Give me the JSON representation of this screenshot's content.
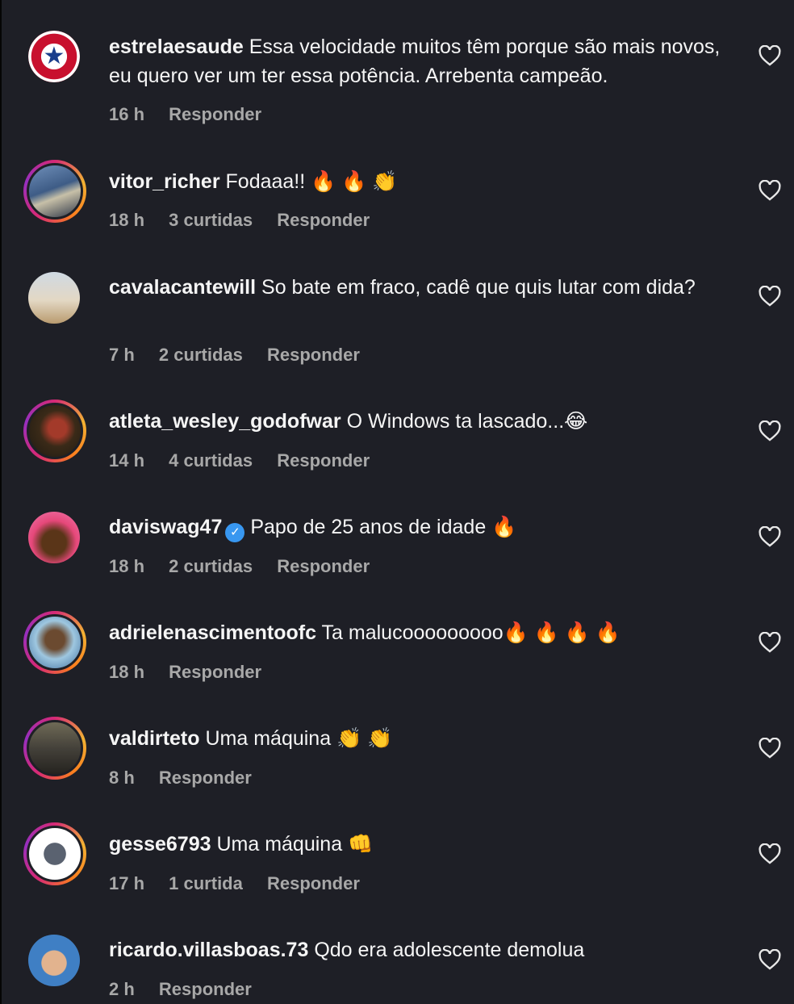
{
  "comments": [
    {
      "username": "estrelaesaude",
      "text": "Essa velocidade muitos têm porque são mais novos, eu quero ver um ter essa potência. Arrebenta campeão.",
      "time": "16 h",
      "likes": "",
      "reply_label": "Responder",
      "avatar_icon": "star-logo"
    },
    {
      "username": "vitor_richer",
      "text": "Fodaaa!! 🔥 🔥 👏",
      "time": "18 h",
      "likes": "3 curtidas",
      "reply_label": "Responder"
    },
    {
      "username": "cavalacantewill",
      "text": "So bate em fraco, cadê que quis lutar com dida?",
      "time": "7 h",
      "likes": "2 curtidas",
      "reply_label": "Responder"
    },
    {
      "username": "atleta_wesley_godofwar",
      "text": "O Windows ta lascado...😂",
      "time": "14 h",
      "likes": "4 curtidas",
      "reply_label": "Responder"
    },
    {
      "username": "daviswag47",
      "text": "Papo de 25 anos de idade 🔥",
      "time": "18 h",
      "likes": "2 curtidas",
      "reply_label": "Responder",
      "verified": true
    },
    {
      "username": "adrielenascimentoofc",
      "text": "Ta malucooooooooo🔥 🔥 🔥 🔥",
      "time": "18 h",
      "likes": "",
      "reply_label": "Responder"
    },
    {
      "username": "valdirteto",
      "text": "Uma máquina 👏 👏",
      "time": "8 h",
      "likes": "",
      "reply_label": "Responder"
    },
    {
      "username": "gesse6793",
      "text": "Uma máquina 👊",
      "time": "17 h",
      "likes": "1 curtida",
      "reply_label": "Responder"
    },
    {
      "username": "ricardo.villasboas.73",
      "text": "Qdo era adolescente demolua",
      "time": "2 h",
      "likes": "",
      "reply_label": "Responder"
    }
  ],
  "icons": {
    "like": "heart-icon",
    "verified": "verified-badge-icon"
  },
  "colors": {
    "background": "#1e1f26",
    "text": "#f5f5f5",
    "meta": "#a8a8a8",
    "verified": "#3897f0"
  }
}
